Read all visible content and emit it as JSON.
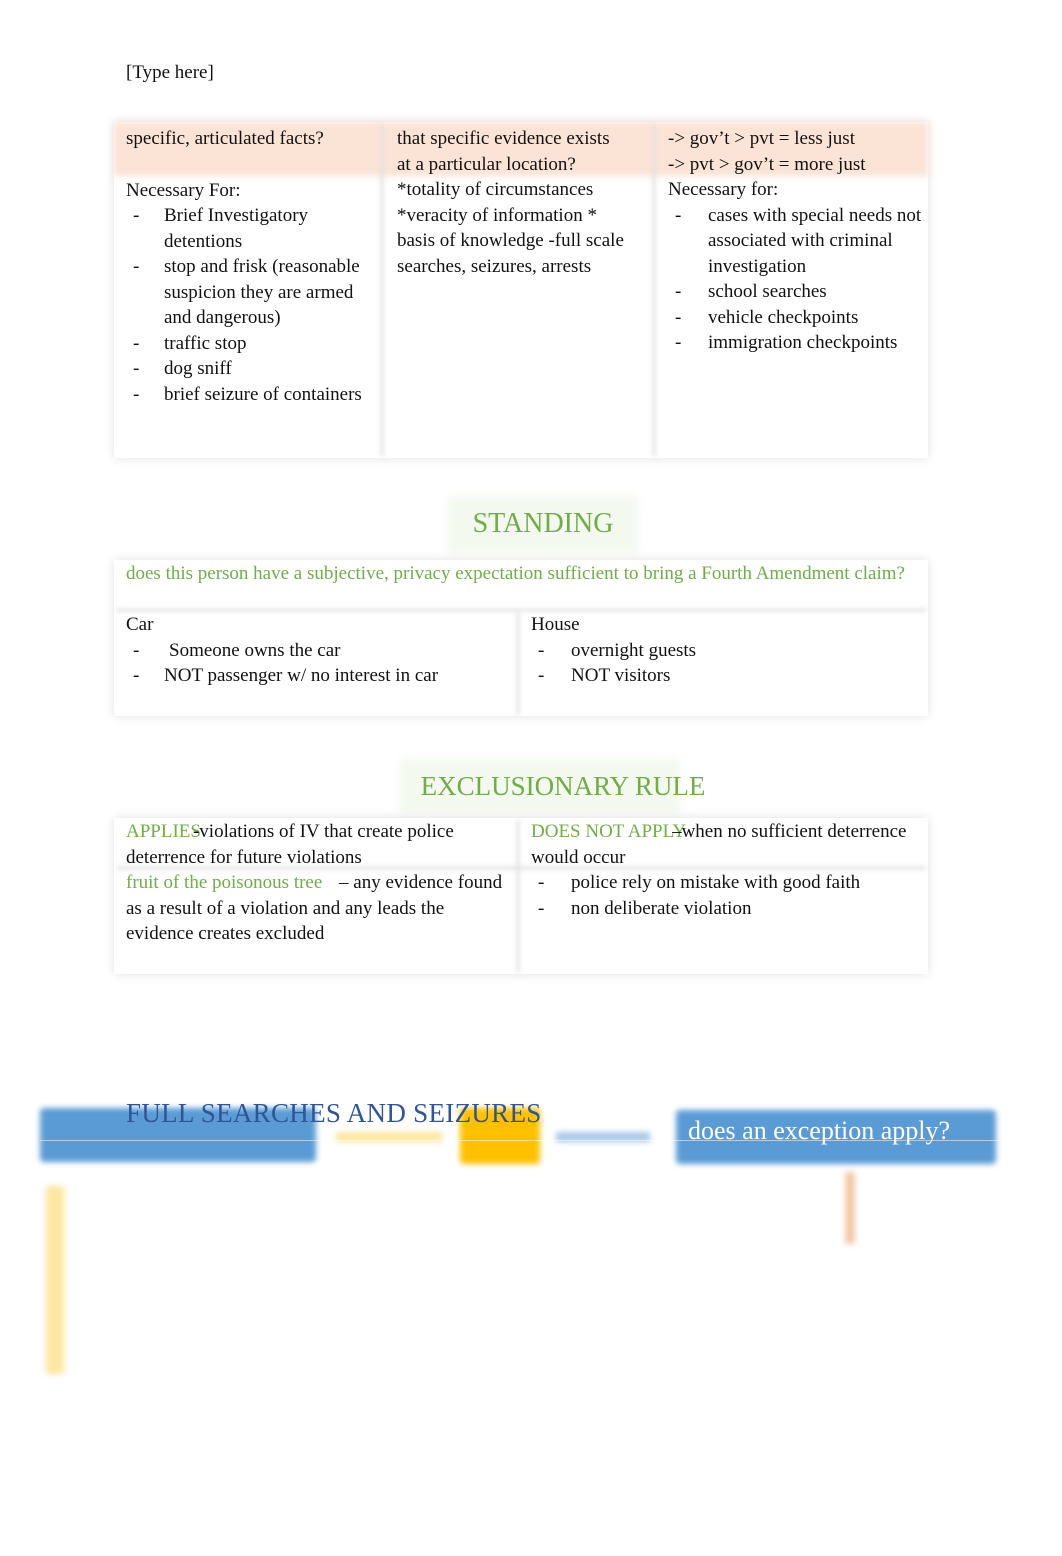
{
  "header": {
    "placeholder": "[Type here]"
  },
  "colors": {
    "green_accent": "#70ad47",
    "peach_band": "#fbe3d6",
    "blue_box": "#5b9bd5",
    "yellow_box": "#ffc000",
    "title_blue": "#2f5597"
  },
  "top_table": {
    "columns": [
      {
        "heading_lines": [
          "specific, articulated facts?"
        ],
        "subheading": "Necessary For:",
        "items": [
          "Brief Investigatory detentions",
          "stop and frisk (reasonable suspicion they are armed and dangerous)",
          "traffic stop",
          "dog sniff",
          "brief seizure of containers"
        ]
      },
      {
        "heading_lines": [
          "that specific evidence exists",
          "at a particular location?"
        ],
        "body_lines": [
          "*totality of circumstances",
          "*veracity of information *",
          "basis of knowledge -full scale",
          "searches, seizures, arrests"
        ]
      },
      {
        "heading_lines": [
          "-> gov’t > pvt = less just",
          "-> pvt > gov’t = more just"
        ],
        "subheading": "Necessary for:",
        "items": [
          "cases with special needs not associated with criminal investigation",
          "school searches",
          "vehicle checkpoints",
          "immigration checkpoints"
        ]
      }
    ]
  },
  "standing": {
    "title": "STANDING",
    "question": "does this person have a subjective, privacy expectation sufficient to bring a Fourth Amendment claim?",
    "car": {
      "label": "Car",
      "items": [
        "Someone owns the car",
        "NOT passenger w/ no interest in car"
      ]
    },
    "house": {
      "label": "House",
      "items": [
        "overnight guests",
        "NOT visitors"
      ]
    }
  },
  "exclusionary_rule": {
    "title": "EXCLUSIONARY RULE",
    "applies": {
      "label": "APPLIES",
      "text": "-violations of IV that create police deterrence for future violations",
      "fruit_label": "fruit of the poisonous tree",
      "fruit_text": " – any evidence found as a result of a violation and any leads the evidence creates excluded"
    },
    "does_not_apply": {
      "label": "DOES NOT APPLY",
      "text": "–when no sufficient deterrence would occur",
      "items": [
        "police rely on mistake with good faith",
        "non deliberate violation"
      ]
    }
  },
  "full_searches": {
    "title": "FULL SEARCHES AND SEIZURES",
    "exception_box": "does an exception apply?"
  }
}
